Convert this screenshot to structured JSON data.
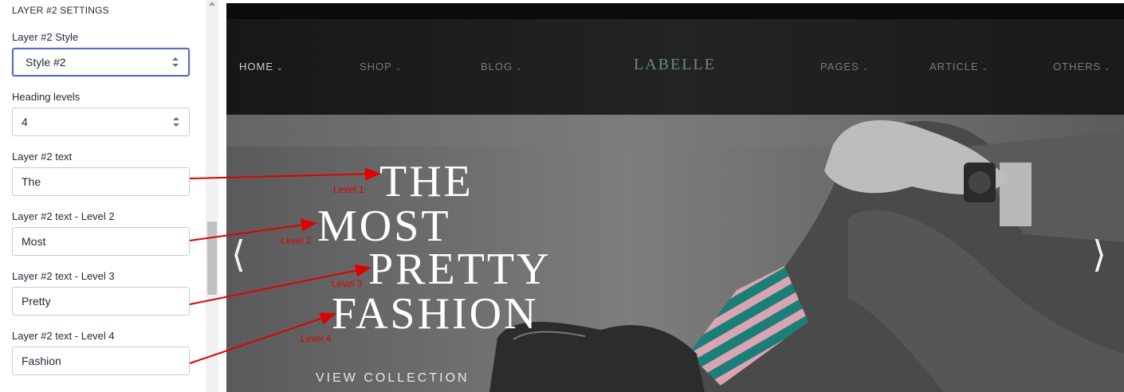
{
  "panel": {
    "section_title": "LAYER #2 SETTINGS",
    "style_label": "Layer #2 Style",
    "style_value": "Style #2",
    "heading_levels_label": "Heading levels",
    "heading_levels_value": "4",
    "text1_label": "Layer #2 text",
    "text1_value": "The",
    "text2_label": "Layer #2 text - Level 2",
    "text2_value": "Most",
    "text3_label": "Layer #2 text - Level 3",
    "text3_value": "Pretty",
    "text4_label": "Layer #2 text - Level 4",
    "text4_value": "Fashion"
  },
  "preview": {
    "nav_left": [
      "HOME",
      "SHOP",
      "BLOG"
    ],
    "logo": "LABELLE",
    "nav_right": [
      "PAGES",
      "ARTICLE",
      "OTHERS"
    ],
    "hero_lines": [
      "THE",
      "MOST",
      "PRETTY",
      "FASHION"
    ],
    "cta": "VIEW COLLECTION"
  },
  "annotations": {
    "level1": "Level 1",
    "level2": "Level 2",
    "level3": "Level 3",
    "level4": "Level 4"
  },
  "colors": {
    "annotation": "#e10000",
    "focus_border": "#5c6ac4",
    "logo": "#6d8a86"
  },
  "icons": {
    "nav_dropdown": "chevron-down-icon",
    "select_stepper": "select-stepper-icon",
    "slide_prev": "chevron-left-icon",
    "slide_next": "chevron-right-icon"
  }
}
